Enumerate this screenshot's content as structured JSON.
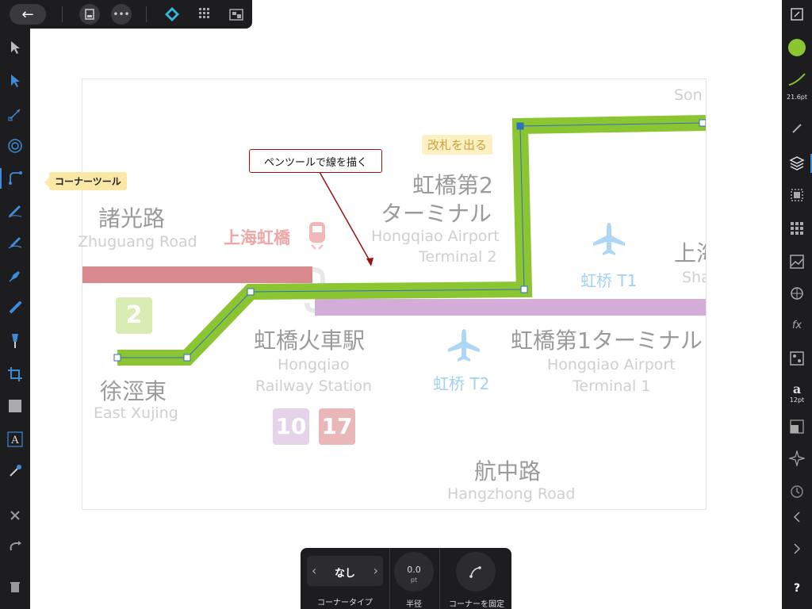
{
  "colors": {
    "accent": "#8bc532",
    "toolbar_bg": "#1d1d1f",
    "callout_border": "#9b1111",
    "tooltip_bg": "#fbe7a6"
  },
  "top_toolbar": {
    "back_icon": "back-arrow-icon",
    "document_icon": "document-icon",
    "more_icon": "more-icon",
    "persona_icons": [
      "designer-persona-icon",
      "pixel-persona-icon",
      "export-persona-icon"
    ]
  },
  "left_tools": [
    "move-tool-icon",
    "node-tool-icon",
    "corner-tool-icon",
    "point-transform-icon",
    "corner-tool-active-icon",
    "pencil-icon",
    "vector-brush-icon",
    "pen-icon",
    "fill-icon",
    "transparency-icon",
    "crop-icon",
    "rectangle-icon",
    "artistic-text-icon",
    "color-picker-icon",
    "close-icon",
    "redo-icon",
    "trash-icon"
  ],
  "corner_tool_tooltip": "コーナーツール",
  "callout_text": "ペンツールで線を描く",
  "right_panel": {
    "stroke_width": "21.6pt",
    "text_size": "12pt",
    "help": "?"
  },
  "map": {
    "labels": [
      {
        "text": "諸光路",
        "cls": "big"
      },
      {
        "text": "Zhuguang Road",
        "cls": "en"
      },
      {
        "text": "上海虹橋",
        "cls": "red"
      },
      {
        "text": "改札を出る",
        "cls": "tag"
      },
      {
        "text": "虹橋第2",
        "cls": "big"
      },
      {
        "text": "ターミナル",
        "cls": "big"
      },
      {
        "text": "Hongqiao Airport",
        "cls": "en"
      },
      {
        "text": "Terminal 2",
        "cls": "en"
      },
      {
        "text": "Son",
        "cls": "en"
      },
      {
        "text": "上海",
        "cls": "big"
      },
      {
        "text": "Sha",
        "cls": "en"
      },
      {
        "text": "虹桥 T1",
        "cls": "blue"
      },
      {
        "text": "2",
        "cls": "badge"
      },
      {
        "text": "虹橋火車駅",
        "cls": "big"
      },
      {
        "text": "Hongqiao",
        "cls": "en"
      },
      {
        "text": "Railway Station",
        "cls": "en"
      },
      {
        "text": "虹橋第1ターミナル",
        "cls": "big"
      },
      {
        "text": "Hongqiao Airport",
        "cls": "en"
      },
      {
        "text": "Terminal 1",
        "cls": "en"
      },
      {
        "text": "虹桥 T2",
        "cls": "blue"
      },
      {
        "text": "徐涇東",
        "cls": "big"
      },
      {
        "text": "East Xujing",
        "cls": "en"
      },
      {
        "text": "10",
        "cls": "badge"
      },
      {
        "text": "17",
        "cls": "badge"
      },
      {
        "text": "航中路",
        "cls": "big"
      },
      {
        "text": "Hangzhong Road",
        "cls": "en"
      }
    ]
  },
  "context_toolbar": {
    "corner_type_value": "なし",
    "corner_type_label": "コーナータイプ",
    "radius_value": "0.0",
    "radius_unit": "pt",
    "radius_label": "半径",
    "lock_corner_label": "コーナーを固定"
  }
}
